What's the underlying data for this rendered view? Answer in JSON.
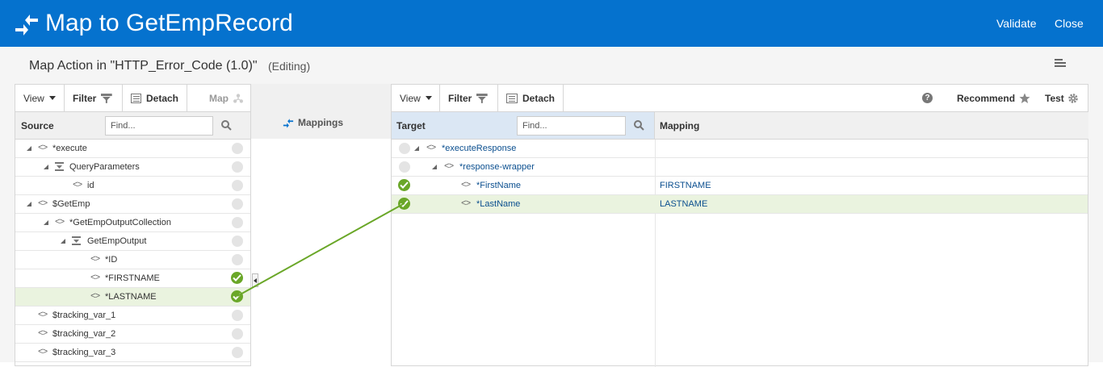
{
  "header": {
    "title": "Map to GetEmpRecord",
    "validate_label": "Validate",
    "close_label": "Close"
  },
  "subheader": {
    "title": "Map Action in \"HTTP_Error_Code (1.0)\"",
    "status": "(Editing)"
  },
  "source": {
    "toolbar": {
      "view": "View",
      "filter": "Filter",
      "detach": "Detach",
      "map": "Map"
    },
    "header_label": "Source",
    "find_placeholder": "Find...",
    "rows": [
      {
        "label": "*execute"
      },
      {
        "label": "QueryParameters"
      },
      {
        "label": "id"
      },
      {
        "label": "$GetEmp"
      },
      {
        "label": "*GetEmpOutputCollection"
      },
      {
        "label": "GetEmpOutput"
      },
      {
        "label": "*ID"
      },
      {
        "label": "*FIRSTNAME"
      },
      {
        "label": "*LASTNAME"
      },
      {
        "label": "$tracking_var_1"
      },
      {
        "label": "$tracking_var_2"
      },
      {
        "label": "$tracking_var_3"
      }
    ]
  },
  "middle": {
    "mappings_label": "Mappings"
  },
  "target": {
    "toolbar": {
      "view": "View",
      "filter": "Filter",
      "detach": "Detach",
      "recommend": "Recommend",
      "test": "Test"
    },
    "header_label": "Target",
    "mapping_header": "Mapping",
    "find_placeholder": "Find...",
    "rows": [
      {
        "label": "*executeResponse",
        "mapping": ""
      },
      {
        "label": "*response-wrapper",
        "mapping": ""
      },
      {
        "label": "*FirstName",
        "mapping": "FIRSTNAME"
      },
      {
        "label": "*LastName",
        "mapping": "LASTNAME"
      }
    ]
  },
  "colors": {
    "brand": "#0572ce",
    "mapped": "#6aa728",
    "link_line": "#6aa728",
    "selected_row": "#eaf3df"
  },
  "icons": [
    "map-arrows-icon",
    "menu-icon",
    "caret-down-icon",
    "filter-icon",
    "detach-icon",
    "map-icon",
    "search-icon",
    "expand-icon",
    "element-tag-icon",
    "collection-icon",
    "mapped-check-icon",
    "unmapped-dot-icon",
    "help-icon",
    "star-icon",
    "gear-icon",
    "collapse-handle-icon"
  ]
}
